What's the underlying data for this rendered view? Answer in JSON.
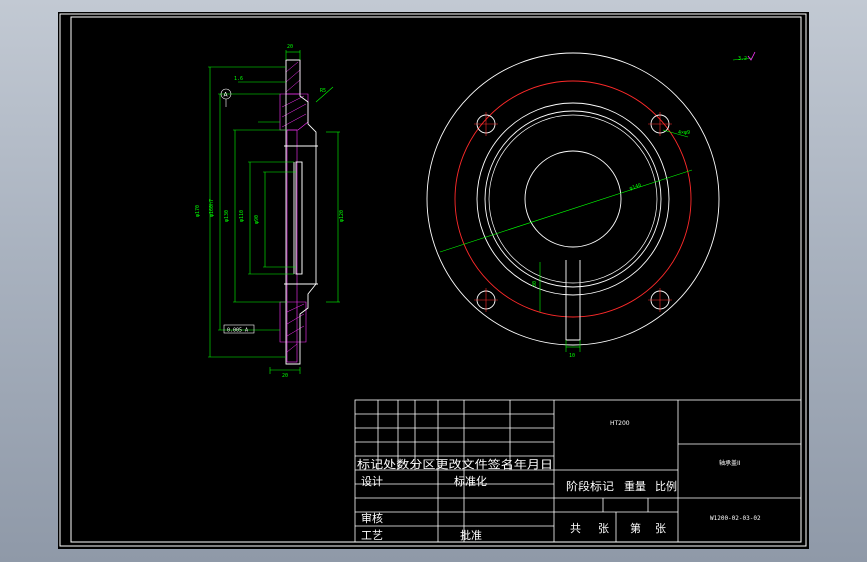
{
  "title_block": {
    "material": "HT200",
    "part_name": "轴承盖II",
    "drawing_no": "W1200-02-03-02",
    "revision_header": "标记处数分区更改文件签名年月日",
    "design": "设计",
    "standardization": "标准化",
    "stage_mark": "阶段标记",
    "weight": "重量",
    "scale": "比例",
    "check": "审核",
    "process": "工艺",
    "approve": "批准",
    "total": "共",
    "sheets": "张",
    "sheet_no": "第",
    "sheet_unit": "张"
  },
  "annotations": {
    "flatness": "0.005 A",
    "datum": "A",
    "roughness": "3.2"
  },
  "colors": {
    "sheet": "#000000",
    "outline": "#ffffff",
    "red": "#ff2a2a",
    "green": "#00ff00",
    "magenta": "#ff33ff",
    "cyan": "#00ffff"
  }
}
